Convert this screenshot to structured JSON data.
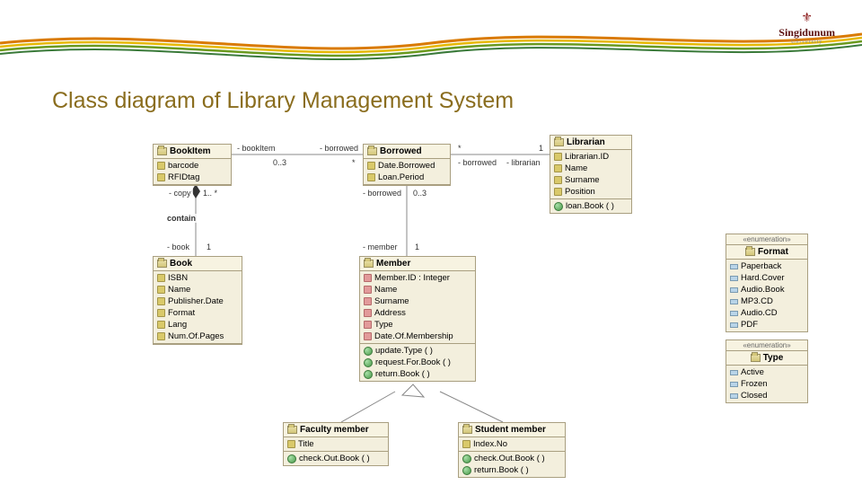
{
  "slide": {
    "title": "Class diagram of Library Management System",
    "logo_name": "Singidunum",
    "logo_sub": "University"
  },
  "classes": {
    "bookItem": {
      "name": "BookItem",
      "attrs": [
        "barcode",
        "RFIDtag"
      ]
    },
    "book": {
      "name": "Book",
      "attrs": [
        "ISBN",
        "Name",
        "Publisher.Date",
        "Format",
        "Lang",
        "Num.Of.Pages"
      ]
    },
    "borrowed": {
      "name": "Borrowed",
      "attrs": [
        "Date.Borrowed",
        "Loan.Period"
      ]
    },
    "librarian": {
      "name": "Librarian",
      "attrs": [
        "Librarian.ID",
        "Name",
        "Surname",
        "Position"
      ],
      "ops": [
        "loan.Book ( )"
      ]
    },
    "member": {
      "name": "Member",
      "attrs": [
        "Member.ID : Integer",
        "Name",
        "Surname",
        "Address",
        "Type",
        "Date.Of.Membership"
      ],
      "ops": [
        "update.Type ( )",
        "request.For.Book ( )",
        "return.Book ( )"
      ]
    },
    "faculty": {
      "name": "Faculty member",
      "attrs": [
        "Title"
      ],
      "ops": [
        "check.Out.Book ( )"
      ]
    },
    "student": {
      "name": "Student member",
      "attrs": [
        "Index.No"
      ],
      "ops": [
        "check.Out.Book ( )",
        "return.Book ( )"
      ]
    },
    "format": {
      "stereotype": "«enumeration»",
      "name": "Format",
      "literals": [
        "Paperback",
        "Hard.Cover",
        "Audio.Book",
        "MP3.CD",
        "Audio.CD",
        "PDF"
      ]
    },
    "type": {
      "stereotype": "«enumeration»",
      "name": "Type",
      "literals": [
        "Active",
        "Frozen",
        "Closed"
      ]
    }
  },
  "labels": {
    "bookItem_role": "- bookItem",
    "borrowed_role1": "- borrowed",
    "borrowed_role2": "- borrowed",
    "librarian_role": "- librarian",
    "member_role": "- member",
    "copy": "- copy",
    "book_role": "- book",
    "contain": "contain",
    "m_1star": "1.. *",
    "m_03a": "0..3",
    "m_03b": "0..3",
    "m_star1": "*",
    "m_star2": "*",
    "m_star3": "*",
    "m_1a": "1",
    "m_1b": "1",
    "m_1c": "1"
  }
}
